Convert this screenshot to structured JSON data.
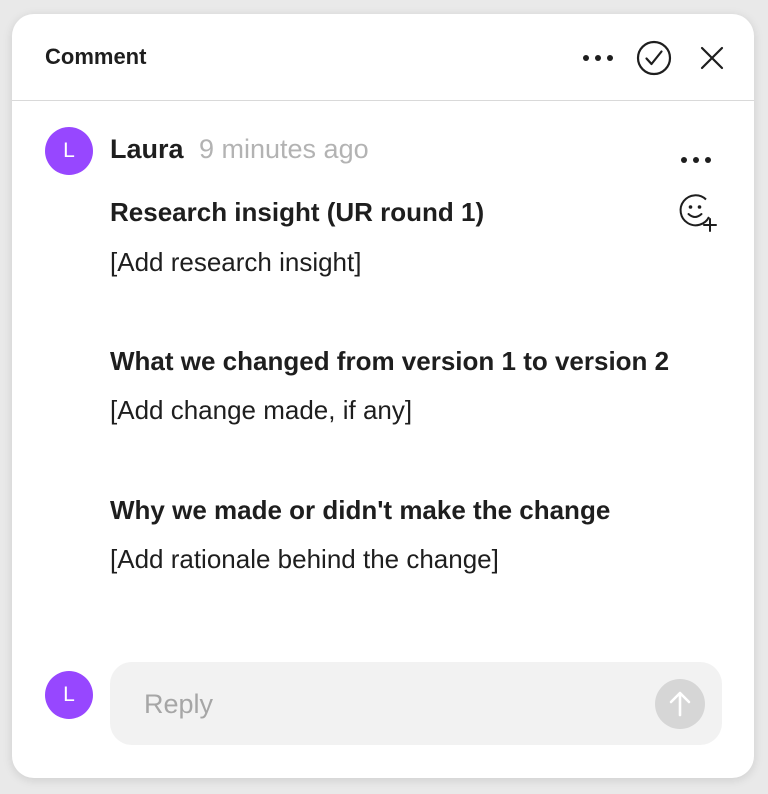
{
  "header": {
    "title": "Comment",
    "icons": [
      "more-horizontal-icon",
      "resolve-check-icon",
      "close-icon"
    ]
  },
  "comment": {
    "avatar_initial": "L",
    "author": "Laura",
    "timestamp": "9 minutes ago",
    "sections": [
      {
        "heading": "Research insight (UR round 1)",
        "text": "[Add research insight]"
      },
      {
        "heading": "What we changed from version 1 to version 2",
        "text": "[Add change made, if any]"
      },
      {
        "heading": "Why we made or didn't make the change",
        "text": "[Add rationale behind the change]"
      }
    ],
    "icons": [
      "more-horizontal-icon",
      "add-reaction-icon"
    ]
  },
  "reply": {
    "avatar_initial": "L",
    "placeholder": "Reply",
    "value": "",
    "send_icon": "arrow-up-icon"
  },
  "colors": {
    "avatar": "#9747ff",
    "muted_text": "#b3b3b3",
    "reply_bg": "#f2f2f2",
    "send_disabled": "#d6d6d6"
  }
}
